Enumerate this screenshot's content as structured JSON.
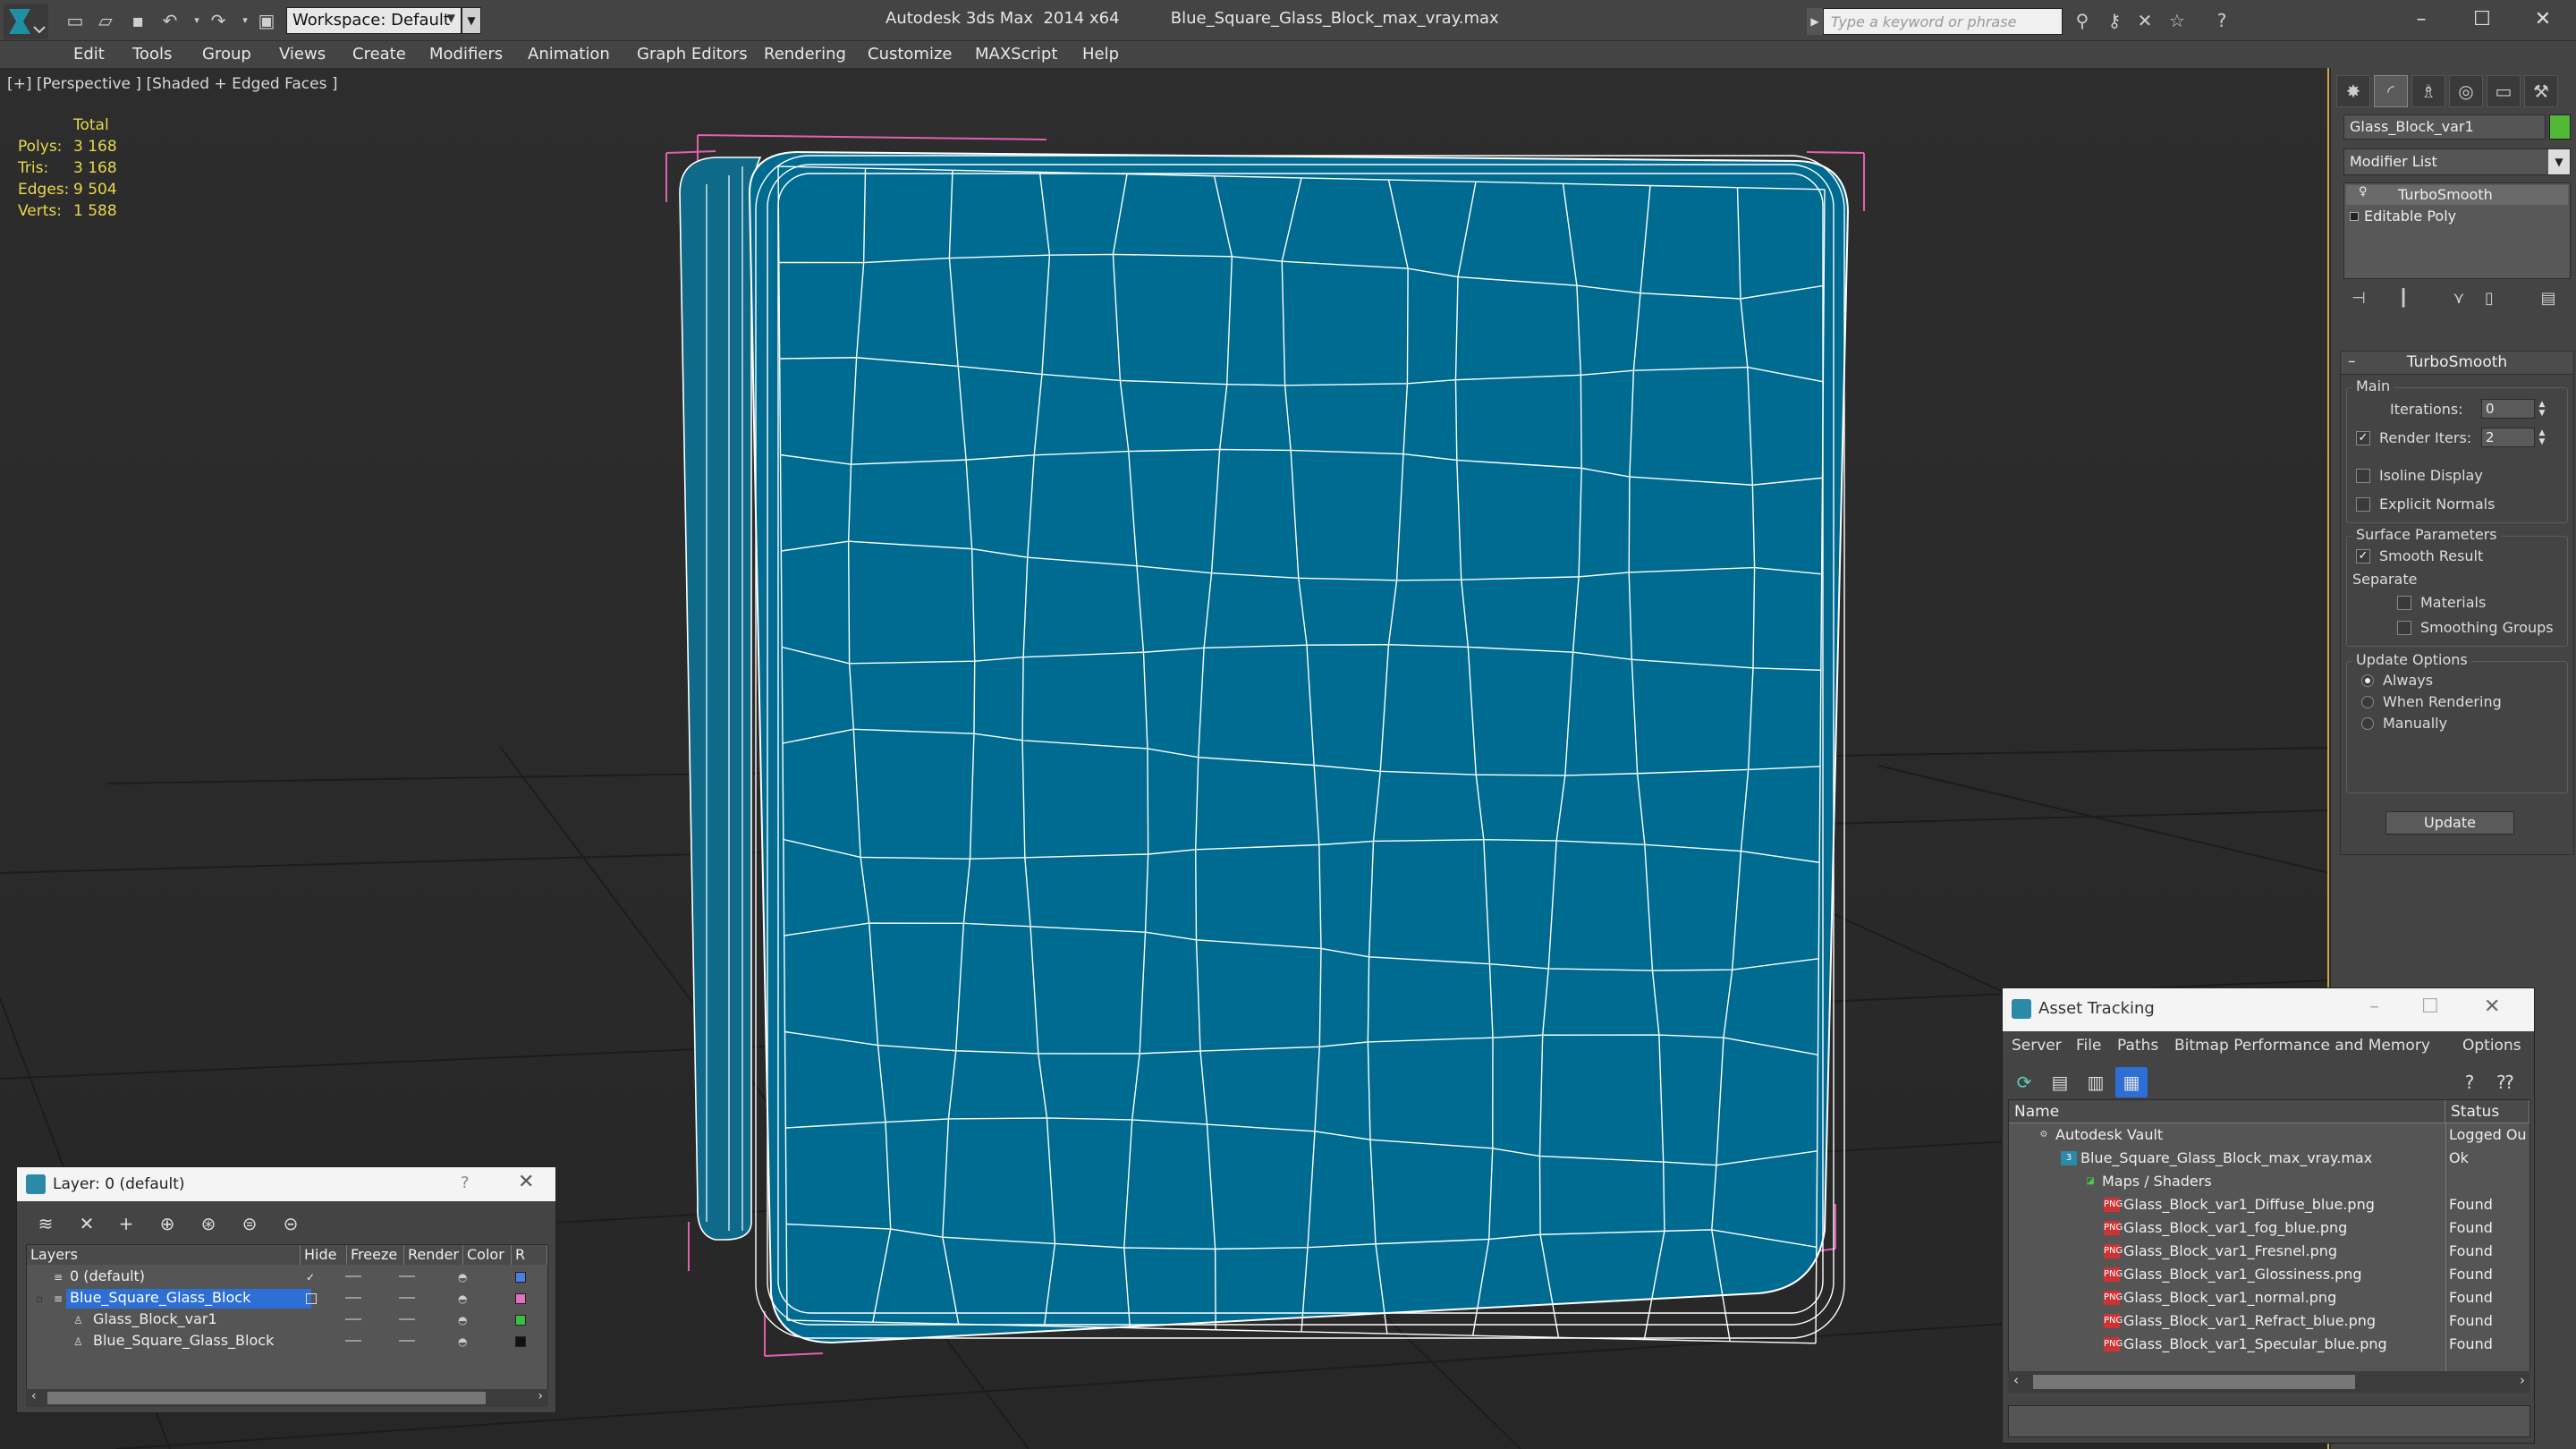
{
  "titlebar": {
    "workspace": "Workspace: Default",
    "app_title": "Autodesk 3ds Max  2014 x64",
    "file_title": "Blue_Square_Glass_Block_max_vray.max",
    "search_placeholder": "Type a keyword or phrase"
  },
  "menu": [
    "Edit",
    "Tools",
    "Group",
    "Views",
    "Create",
    "Modifiers",
    "Animation",
    "Graph Editors",
    "Rendering",
    "Customize",
    "MAXScript",
    "Help"
  ],
  "viewport": {
    "label": "[+] [Perspective ] [Shaded + Edged Faces ]",
    "stats": {
      "total_label": "Total",
      "rows": [
        {
          "label": "Polys:",
          "value": "3 168"
        },
        {
          "label": "Tris:",
          "value": "3 168"
        },
        {
          "label": "Edges:",
          "value": "9 504"
        },
        {
          "label": "Verts:",
          "value": "1 588"
        }
      ]
    }
  },
  "command_panel": {
    "object_name": "Glass_Block_var1",
    "object_color": "#50b836",
    "modifier_list": "Modifier List",
    "stack": [
      "TurboSmooth",
      "Editable Poly"
    ],
    "turbosmooth": {
      "title": "TurboSmooth",
      "main_group": "Main",
      "iterations_label": "Iterations:",
      "iterations_value": "0",
      "render_iters_label": "Render Iters:",
      "render_iters_value": "2",
      "isoline_label": "Isoline Display",
      "explicit_normals_label": "Explicit Normals",
      "surface_group": "Surface Parameters",
      "smooth_result_label": "Smooth Result",
      "separate_label": "Separate",
      "materials_label": "Materials",
      "smoothing_groups_label": "Smoothing Groups",
      "update_group": "Update Options",
      "always_label": "Always",
      "when_rendering_label": "When Rendering",
      "manually_label": "Manually",
      "update_button": "Update"
    }
  },
  "layer_dialog": {
    "title": "Layer: 0 (default)",
    "help": "?",
    "columns": [
      "Layers",
      "Hide",
      "Freeze",
      "Render",
      "Color",
      "R"
    ],
    "rows": [
      {
        "name": "0 (default)",
        "color": "#4a7fe0"
      },
      {
        "name": "Blue_Square_Glass_Block",
        "color": "#e070c0"
      },
      {
        "name": "Glass_Block_var1",
        "color": "#3cc03c"
      },
      {
        "name": "Blue_Square_Glass_Block",
        "color": "#111111"
      }
    ]
  },
  "asset_tracking": {
    "title": "Asset Tracking",
    "menu": [
      "Server",
      "File",
      "Paths",
      "Bitmap Performance and Memory",
      "Options"
    ],
    "columns": [
      "Name",
      "Status"
    ],
    "rows": [
      {
        "name": "Autodesk Vault",
        "status": "Logged Ou"
      },
      {
        "name": "Blue_Square_Glass_Block_max_vray.max",
        "status": "Ok"
      },
      {
        "name": "Maps / Shaders",
        "status": ""
      },
      {
        "name": "Glass_Block_var1_Diffuse_blue.png",
        "status": "Found"
      },
      {
        "name": "Glass_Block_var1_fog_blue.png",
        "status": "Found"
      },
      {
        "name": "Glass_Block_var1_Fresnel.png",
        "status": "Found"
      },
      {
        "name": "Glass_Block_var1_Glossiness.png",
        "status": "Found"
      },
      {
        "name": "Glass_Block_var1_normal.png",
        "status": "Found"
      },
      {
        "name": "Glass_Block_var1_Refract_blue.png",
        "status": "Found"
      },
      {
        "name": "Glass_Block_var1_Specular_blue.png",
        "status": "Found"
      }
    ]
  }
}
